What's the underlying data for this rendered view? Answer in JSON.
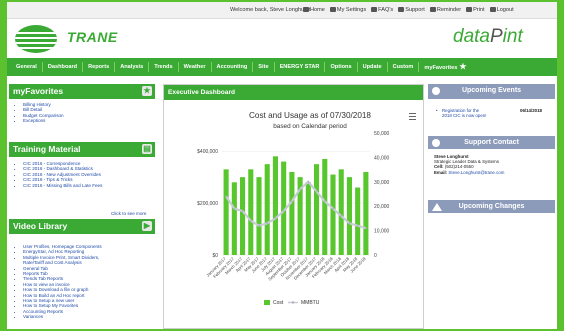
{
  "topbar": {
    "welcome": "Welcome back, Steve Longhurst",
    "links": [
      "Home",
      "My Settings",
      "FAQ's",
      "Support",
      "Reminder",
      "Print",
      "Logout"
    ]
  },
  "header": {
    "brand": "TRANE",
    "product_a": "data",
    "product_b": "P",
    "product_c": "int"
  },
  "nav": {
    "items": [
      "General",
      "Dashboard",
      "Reports",
      "Analysis",
      "Trends",
      "Weather",
      "Accounting",
      "Site",
      "ENERGY STAR",
      "Options",
      "Update",
      "Custom"
    ],
    "favorites": "myFavorites"
  },
  "favorites_panel": {
    "title": "myFavorites",
    "items": [
      "Billing History",
      "Bill Detail",
      "Budget Comparison",
      "Exceptions"
    ]
  },
  "training_panel": {
    "title": "Training Material",
    "items": [
      "CIC 2016 - Correspondence",
      "CIC 2016 - Dashboard & Statistics",
      "CIC 2016 - New Adjustment Overrides",
      "CIC 2016 - Tips & Tricks",
      "CIC 2016 - Missing Bills and Late Fees"
    ],
    "more": "Click to see more"
  },
  "video_panel": {
    "title": "Video Library",
    "items": [
      "User Profiles, Homepage Components",
      "EnergyStar, Ad Hoc Reporting",
      "Multiple Invoice Print, Smart Dividers,",
      "Rate/Tariff and Cost Analysis",
      "General Tab",
      "Reports Tab",
      "Trends Tab Reports",
      "How to view an invoice",
      "How to Download a file or graph",
      "How to Build an Ad Hoc report",
      "How to Setup a new user",
      "How to Setup My Favorites",
      "Accounting Reports",
      "Variances"
    ]
  },
  "dashboard": {
    "title": "Executive Dashboard"
  },
  "events_panel": {
    "title": "Upcoming Events",
    "event_text_1": "Registration for the",
    "event_text_2": "2018 CIC is now open!",
    "event_date": "06/14/2018"
  },
  "support_panel": {
    "title": "Support Contact",
    "name": "Steve Longhurst",
    "role": "Strategic Leader Data & Systems",
    "cell_label": "Cell:",
    "cell": "(502)214-0550",
    "email_label": "Email:",
    "email": "Steve.Longhurst@trane.com"
  },
  "changes_panel": {
    "title": "Upcoming Changes"
  },
  "colors": {
    "brand_green": "#3aaa35",
    "bg_green": "#5cc12e",
    "bar": "#58c72d",
    "line": "#c8cbd6",
    "right_header": "#8d9bbb"
  },
  "chart_data": {
    "type": "bar",
    "title": "Cost and Usage as of 07/30/2018",
    "subtitle": "based on Calendar period",
    "categories": [
      "January 2017",
      "February 2017",
      "March 2017",
      "April 2017",
      "May 2017",
      "June 2017",
      "July 2017",
      "August 2017",
      "September 2017",
      "October 2017",
      "November 2017",
      "December 2017",
      "January 2018",
      "February 2018",
      "March 2018",
      "April 2018",
      "May 2018",
      "June 2018"
    ],
    "y_left_ticks": [
      "$0",
      "$200,000",
      "$400,000"
    ],
    "y_right_ticks": [
      "0",
      "10,000",
      "20,000",
      "30,000",
      "40,000",
      "50,000"
    ],
    "ylim_left": [
      0,
      470000
    ],
    "ylim_right": [
      0,
      50000
    ],
    "series": [
      {
        "name": "Cost",
        "type": "bar",
        "values": [
          330000,
          280000,
          300000,
          330000,
          300000,
          350000,
          380000,
          360000,
          320000,
          300000,
          280000,
          350000,
          370000,
          310000,
          330000,
          300000,
          260000,
          320000
        ]
      },
      {
        "name": "MMBTU",
        "type": "line",
        "values": [
          24000,
          19000,
          18000,
          14000,
          12000,
          13000,
          15000,
          18000,
          22000,
          27000,
          30000,
          26000,
          22000,
          19000,
          16000,
          13000,
          12000,
          11000
        ]
      }
    ],
    "legend": [
      "Cost",
      "MMBTU"
    ],
    "legend_position": "bottom"
  }
}
